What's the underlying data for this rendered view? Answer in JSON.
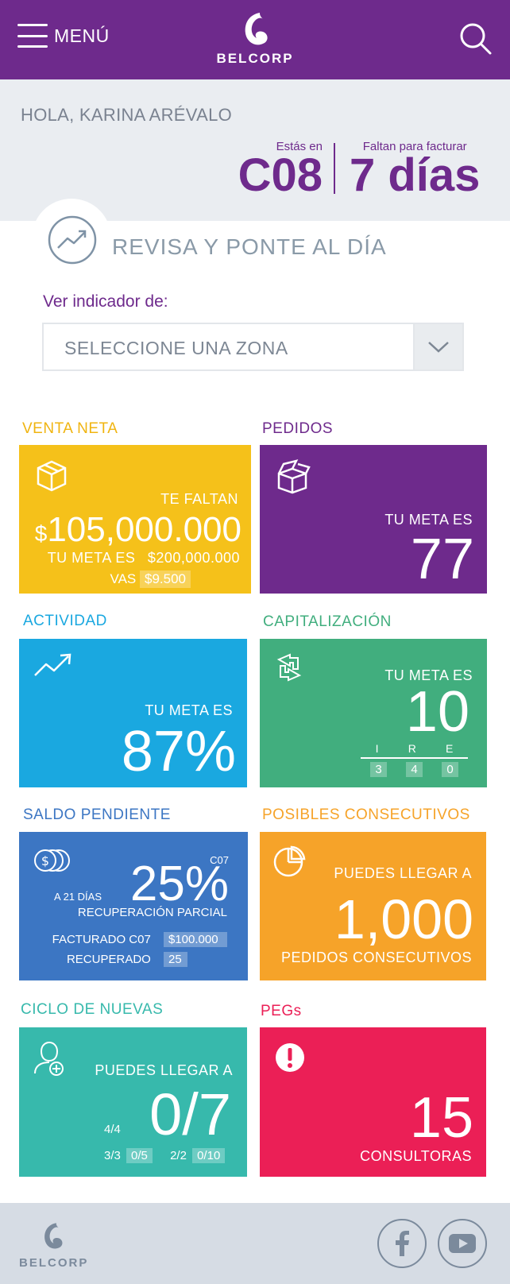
{
  "header": {
    "menu_label": "MENÚ",
    "brand": "BELCORP"
  },
  "greeting": {
    "text": "HOLA, KARINA ARÉVALO",
    "campaign_label": "Estás en",
    "campaign_value": "C08",
    "billing_label": "Faltan para facturar",
    "billing_value": "7 días"
  },
  "revisa": {
    "title": "REVISA Y PONTE AL DÍA",
    "indicator_label": "Ver indicador de:",
    "zone_placeholder": "SELECCIONE UNA ZONA"
  },
  "cards": {
    "venta_neta": {
      "title": "VENTA NETA",
      "faltan_label": "TE FALTAN",
      "currency": "$",
      "amount": "105,000.000",
      "meta_label": "TU META ES",
      "meta_value": "$200,000.000",
      "vas_label": "VAS",
      "vas_value": "$9.500",
      "color": "#f5c11a"
    },
    "pedidos": {
      "title": "PEDIDOS",
      "meta_label": "TU META ES",
      "meta_value": "77",
      "color": "#6e2a8c"
    },
    "actividad": {
      "title": "ACTIVIDAD",
      "meta_label": "TU META ES",
      "meta_value": "87%",
      "color": "#1aa8e0"
    },
    "capitalizacion": {
      "title": "CAPITALIZACIÓN",
      "meta_label": "TU META ES",
      "meta_value": "10",
      "headers": [
        "I",
        "R",
        "E"
      ],
      "values": [
        "3",
        "4",
        "0"
      ],
      "color": "#41ae7e"
    },
    "saldo": {
      "title": "SALDO PENDIENTE",
      "campaign": "C07",
      "days_label": "A 21 DÍAS",
      "percent": "25%",
      "recovery_label": "RECUPERACIÓN PARCIAL",
      "facturado_label": "FACTURADO C07",
      "facturado_value": "$100.000",
      "recuperado_label": "RECUPERADO",
      "recuperado_value": "25",
      "color": "#3c76c3"
    },
    "consecutivos": {
      "title": "POSIBLES CONSECUTIVOS",
      "label": "PUEDES LLEGAR A",
      "value": "1,000",
      "sub": "PEDIDOS CONSECUTIVOS",
      "color": "#f6a329"
    },
    "nuevas": {
      "title": "CICLO DE NUEVAS",
      "label": "PUEDES LLEGAR A",
      "value": "0/7",
      "stat1": "4/4",
      "stat2": "3/3",
      "chip2": "0/5",
      "stat3": "2/2",
      "chip3": "0/10",
      "color": "#37b9ac"
    },
    "pegs": {
      "title": "PEGs",
      "value": "15",
      "sub": "CONSULTORAS",
      "color": "#eb1f56"
    }
  },
  "footer": {
    "brand": "BELCORP",
    "icons": [
      "facebook-icon",
      "youtube-icon"
    ]
  },
  "colors": {
    "primary": "#6e2a8c",
    "greet_bg": "#eaedf1",
    "footer_bg": "#d6dce4"
  }
}
